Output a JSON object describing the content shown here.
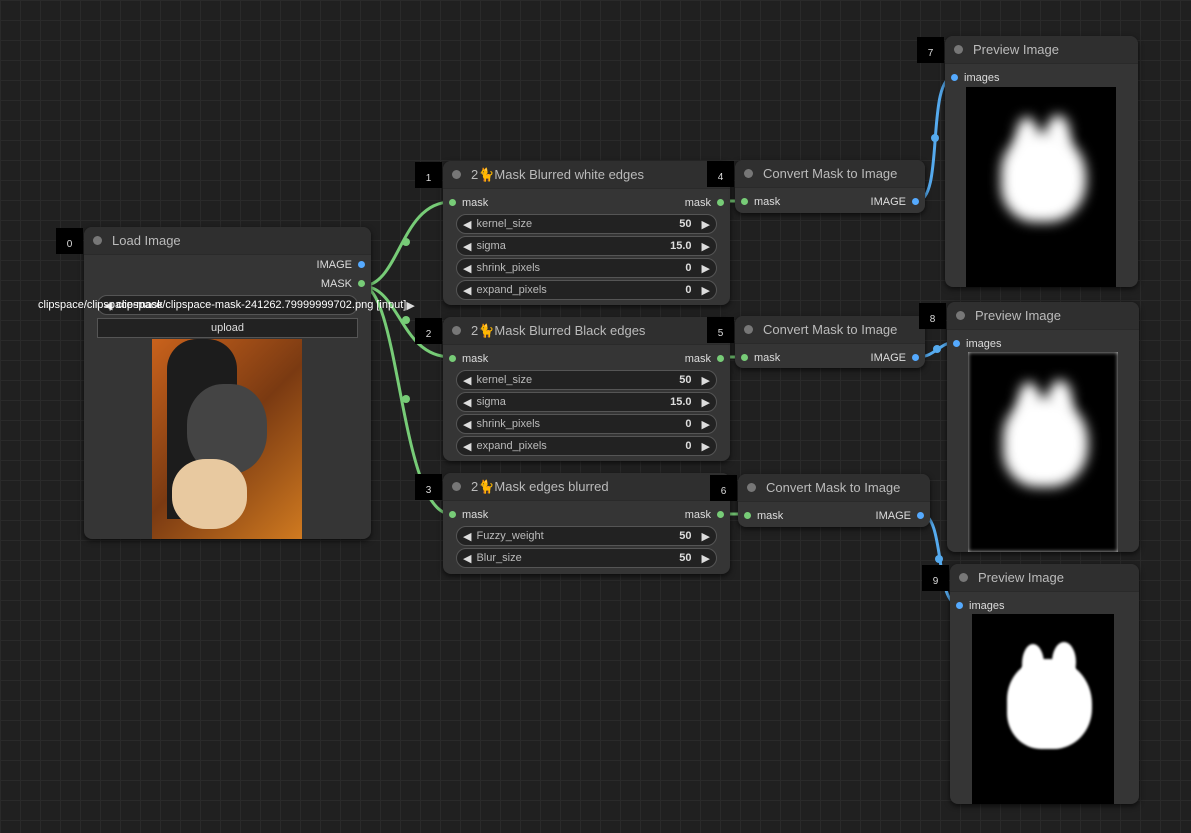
{
  "nodes": [
    {
      "id": "0",
      "title": "Load Image",
      "outputs": [
        {
          "label": "IMAGE",
          "type": "b"
        },
        {
          "label": "MASK",
          "type": "g"
        }
      ],
      "file": "clipspace/clipspace-mask-241262.79999999702.png [input]",
      "file_overflow": "clipspace/clipspace-mask",
      "upload": "upload"
    },
    {
      "id": "1",
      "title": "2🐈Mask Blurred white edges",
      "input": "mask",
      "output": "mask",
      "widgets": [
        {
          "label": "kernel_size",
          "value": "50"
        },
        {
          "label": "sigma",
          "value": "15.0"
        },
        {
          "label": "shrink_pixels",
          "value": "0"
        },
        {
          "label": "expand_pixels",
          "value": "0"
        }
      ]
    },
    {
      "id": "2",
      "title": "2🐈Mask Blurred Black edges",
      "input": "mask",
      "output": "mask",
      "widgets": [
        {
          "label": "kernel_size",
          "value": "50"
        },
        {
          "label": "sigma",
          "value": "15.0"
        },
        {
          "label": "shrink_pixels",
          "value": "0"
        },
        {
          "label": "expand_pixels",
          "value": "0"
        }
      ]
    },
    {
      "id": "3",
      "title": "2🐈Mask edges blurred",
      "input": "mask",
      "output": "mask",
      "widgets": [
        {
          "label": "Fuzzy_weight",
          "value": "50"
        },
        {
          "label": "Blur_size",
          "value": "50"
        }
      ]
    },
    {
      "id": "4",
      "title": "Convert Mask to Image",
      "input": "mask",
      "output": "IMAGE"
    },
    {
      "id": "5",
      "title": "Convert Mask to Image",
      "input": "mask",
      "output": "IMAGE"
    },
    {
      "id": "6",
      "title": "Convert Mask to Image",
      "input": "mask",
      "output": "IMAGE"
    },
    {
      "id": "7",
      "title": "Preview Image",
      "input": "images"
    },
    {
      "id": "8",
      "title": "Preview Image",
      "input": "images"
    },
    {
      "id": "9",
      "title": "Preview Image",
      "input": "images"
    }
  ],
  "colors": {
    "mask_wire": "#7fc77f",
    "image_wire": "#5aaaee",
    "canvas": "#202020",
    "node": "#353535"
  }
}
